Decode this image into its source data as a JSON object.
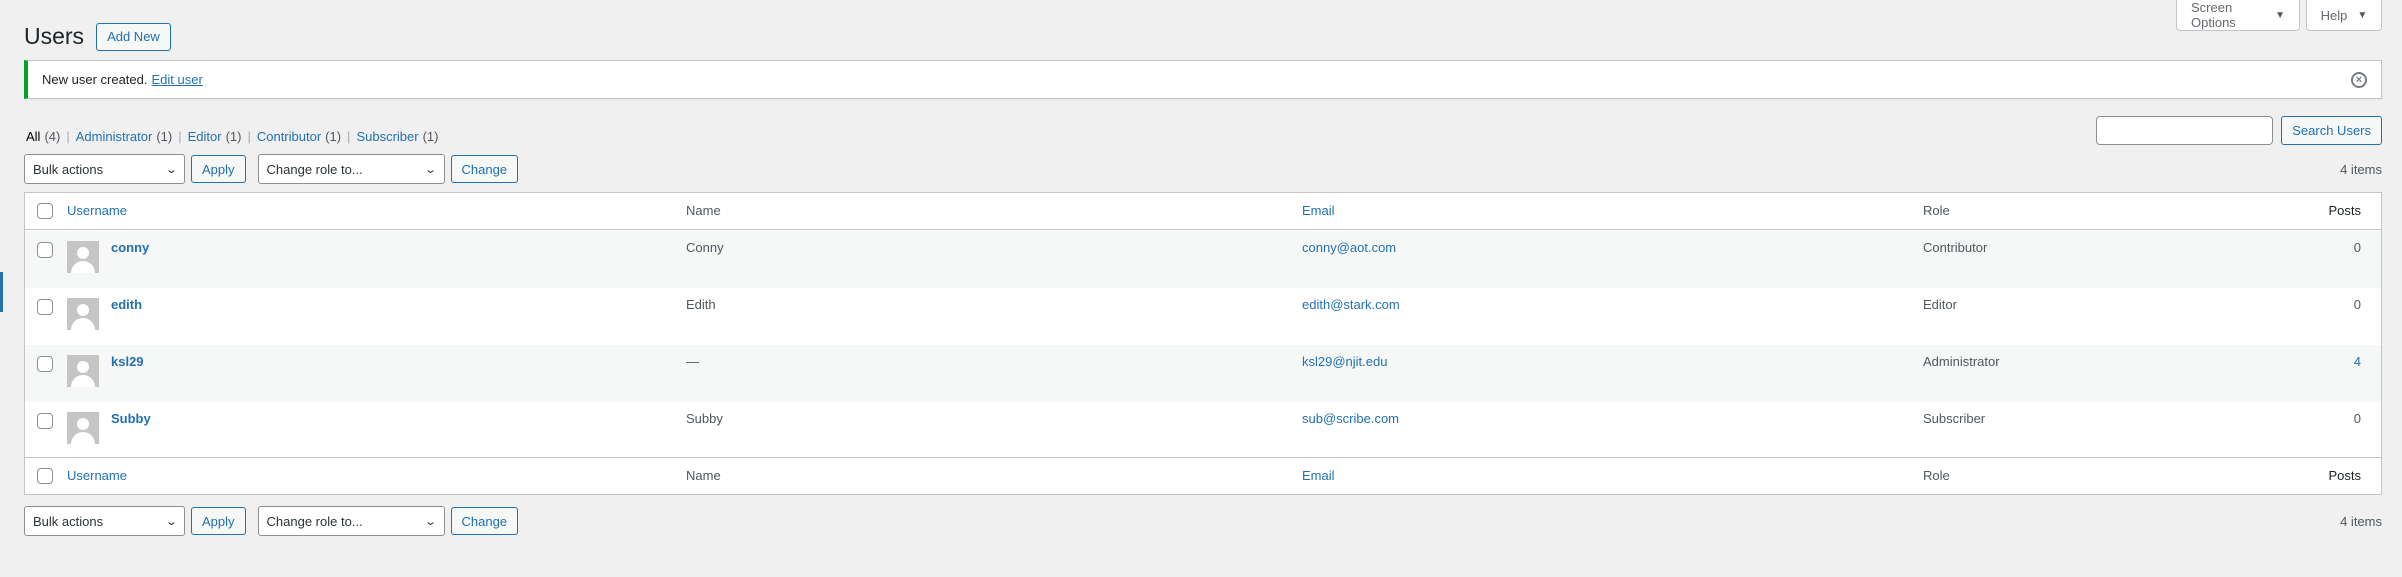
{
  "screen_meta": {
    "screen_options": "Screen Options",
    "help": "Help"
  },
  "header": {
    "title": "Users",
    "add_new": "Add New"
  },
  "notice": {
    "message": "New user created.",
    "link": "Edit user"
  },
  "filters": [
    {
      "label": "All",
      "count": "(4)"
    },
    {
      "label": "Administrator",
      "count": "(1)"
    },
    {
      "label": "Editor",
      "count": "(1)"
    },
    {
      "label": "Contributor",
      "count": "(1)"
    },
    {
      "label": "Subscriber",
      "count": "(1)"
    }
  ],
  "search": {
    "button": "Search Users",
    "value": ""
  },
  "tablenav": {
    "bulk_actions": "Bulk actions",
    "apply": "Apply",
    "change_role": "Change role to...",
    "change": "Change",
    "items_count": "4 items"
  },
  "table": {
    "columns": {
      "username": "Username",
      "name": "Name",
      "email": "Email",
      "role": "Role",
      "posts": "Posts"
    },
    "rows": [
      {
        "username": "conny",
        "name": "Conny",
        "email": "conny@aot.com",
        "role": "Contributor",
        "posts": "0"
      },
      {
        "username": "edith",
        "name": "Edith",
        "email": "edith@stark.com",
        "role": "Editor",
        "posts": "0"
      },
      {
        "username": "ksl29",
        "name": "—",
        "email": "ksl29@njit.edu",
        "role": "Administrator",
        "posts": "4"
      },
      {
        "username": "Subby",
        "name": "Subby",
        "email": "sub@scribe.com",
        "role": "Subscriber",
        "posts": "0"
      }
    ]
  },
  "colors": {
    "link": "#2271b1",
    "success": "#00a32a",
    "background": "#f0f0f1"
  }
}
